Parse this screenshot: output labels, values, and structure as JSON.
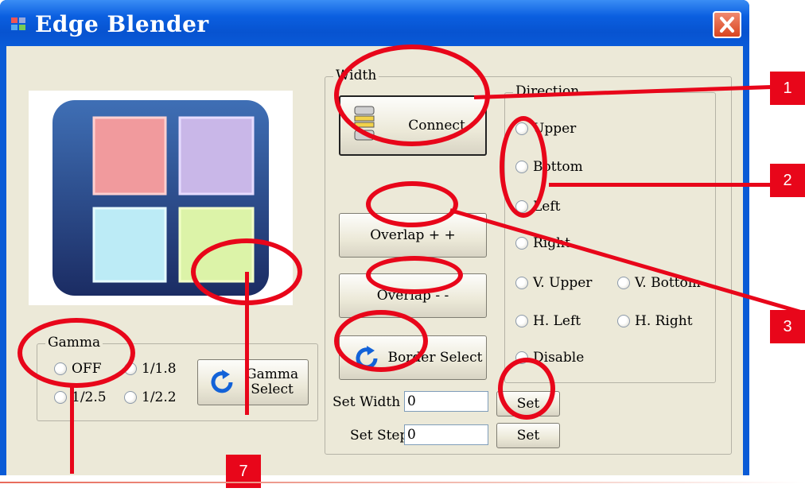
{
  "window": {
    "title": "Edge Blender"
  },
  "gamma": {
    "group_title": "Gamma",
    "options": [
      "OFF",
      "1/1.8",
      "1/2.5",
      "1/2.2"
    ],
    "select_button": [
      "Gamma",
      "Select"
    ]
  },
  "width": {
    "group_title": "Width",
    "connect_label": "Connect",
    "overlap_plus_label": "Overlap + +",
    "overlap_minus_label": "Overlap - -",
    "border_select_label": "Border Select",
    "set_width_label": "Set Width",
    "set_width_value": "0",
    "set_step_label": "Set Step",
    "set_step_value": "0",
    "set_label": "Set"
  },
  "direction": {
    "group_title": "Direction",
    "options": [
      "Upper",
      "Bottom",
      "Left",
      "Right",
      "V. Upper",
      "V. Bottom",
      "H. Left",
      "H. Right",
      "Disable"
    ]
  },
  "callouts": [
    "1",
    "2",
    "3",
    "7"
  ],
  "colors": {
    "titlebar": "#0b5fe0",
    "annotation": "#e8061a",
    "dialog": "#ece9d8"
  }
}
